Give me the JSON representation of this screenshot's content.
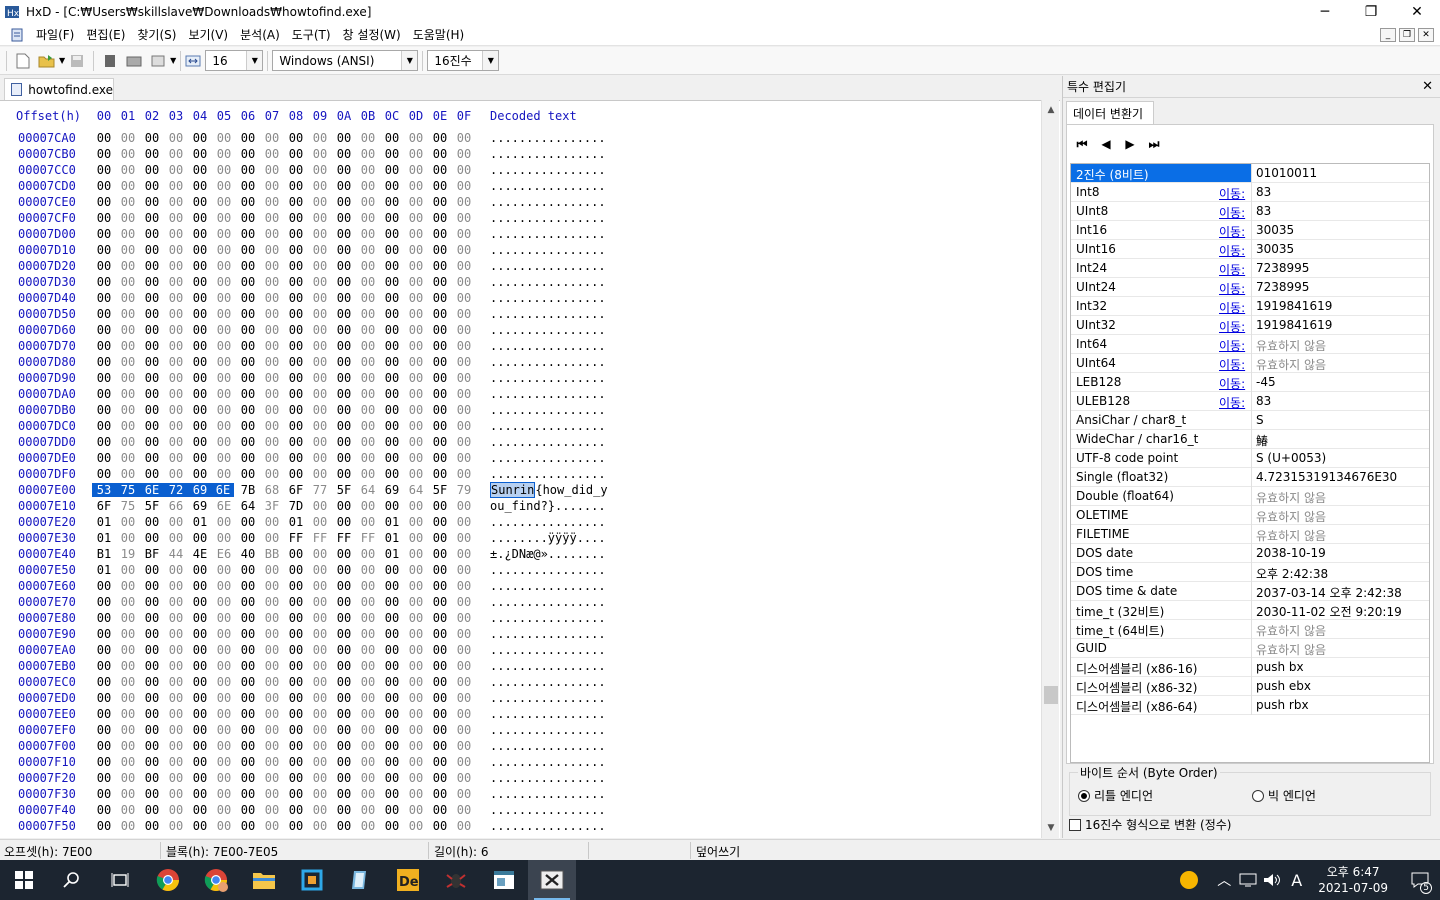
{
  "window": {
    "title": "HxD - [C:₩Users₩skillslave₩Downloads₩howtofind.exe]",
    "minimize": "─",
    "maximize": "❐",
    "close": "✕"
  },
  "menu": [
    "파일(F)",
    "편집(E)",
    "찾기(S)",
    "보기(V)",
    "분석(A)",
    "도구(T)",
    "창 설정(W)",
    "도움말(H)"
  ],
  "toolbar": {
    "bytes_per_row": "16",
    "charset": "Windows (ANSI)",
    "offset_base": "16진수"
  },
  "tab": {
    "label": "howtofind.exe"
  },
  "hex_header": {
    "offset": "Offset(h)",
    "cols": [
      "00",
      "01",
      "02",
      "03",
      "04",
      "05",
      "06",
      "07",
      "08",
      "09",
      "0A",
      "0B",
      "0C",
      "0D",
      "0E",
      "0F"
    ],
    "decoded": "Decoded text"
  },
  "rows": [
    {
      "off": "00007CA0",
      "bytes": "00 00 00 00 00 00 00 00 00 00 00 00 00 00 00 00",
      "text": "................"
    },
    {
      "off": "00007CB0",
      "bytes": "00 00 00 00 00 00 00 00 00 00 00 00 00 00 00 00",
      "text": "................"
    },
    {
      "off": "00007CC0",
      "bytes": "00 00 00 00 00 00 00 00 00 00 00 00 00 00 00 00",
      "text": "................"
    },
    {
      "off": "00007CD0",
      "bytes": "00 00 00 00 00 00 00 00 00 00 00 00 00 00 00 00",
      "text": "................"
    },
    {
      "off": "00007CE0",
      "bytes": "00 00 00 00 00 00 00 00 00 00 00 00 00 00 00 00",
      "text": "................"
    },
    {
      "off": "00007CF0",
      "bytes": "00 00 00 00 00 00 00 00 00 00 00 00 00 00 00 00",
      "text": "................"
    },
    {
      "off": "00007D00",
      "bytes": "00 00 00 00 00 00 00 00 00 00 00 00 00 00 00 00",
      "text": "................"
    },
    {
      "off": "00007D10",
      "bytes": "00 00 00 00 00 00 00 00 00 00 00 00 00 00 00 00",
      "text": "................"
    },
    {
      "off": "00007D20",
      "bytes": "00 00 00 00 00 00 00 00 00 00 00 00 00 00 00 00",
      "text": "................"
    },
    {
      "off": "00007D30",
      "bytes": "00 00 00 00 00 00 00 00 00 00 00 00 00 00 00 00",
      "text": "................"
    },
    {
      "off": "00007D40",
      "bytes": "00 00 00 00 00 00 00 00 00 00 00 00 00 00 00 00",
      "text": "................"
    },
    {
      "off": "00007D50",
      "bytes": "00 00 00 00 00 00 00 00 00 00 00 00 00 00 00 00",
      "text": "................"
    },
    {
      "off": "00007D60",
      "bytes": "00 00 00 00 00 00 00 00 00 00 00 00 00 00 00 00",
      "text": "................"
    },
    {
      "off": "00007D70",
      "bytes": "00 00 00 00 00 00 00 00 00 00 00 00 00 00 00 00",
      "text": "................"
    },
    {
      "off": "00007D80",
      "bytes": "00 00 00 00 00 00 00 00 00 00 00 00 00 00 00 00",
      "text": "................"
    },
    {
      "off": "00007D90",
      "bytes": "00 00 00 00 00 00 00 00 00 00 00 00 00 00 00 00",
      "text": "................"
    },
    {
      "off": "00007DA0",
      "bytes": "00 00 00 00 00 00 00 00 00 00 00 00 00 00 00 00",
      "text": "................"
    },
    {
      "off": "00007DB0",
      "bytes": "00 00 00 00 00 00 00 00 00 00 00 00 00 00 00 00",
      "text": "................"
    },
    {
      "off": "00007DC0",
      "bytes": "00 00 00 00 00 00 00 00 00 00 00 00 00 00 00 00",
      "text": "................"
    },
    {
      "off": "00007DD0",
      "bytes": "00 00 00 00 00 00 00 00 00 00 00 00 00 00 00 00",
      "text": "................"
    },
    {
      "off": "00007DE0",
      "bytes": "00 00 00 00 00 00 00 00 00 00 00 00 00 00 00 00",
      "text": "................"
    },
    {
      "off": "00007DF0",
      "bytes": "00 00 00 00 00 00 00 00 00 00 00 00 00 00 00 00",
      "text": "................"
    },
    {
      "off": "00007E00",
      "bytes": "53 75 6E 72 69 6E 7B 68 6F 77 5F 64 69 64 5F 79",
      "text": "Sunrin{how_did_y",
      "sel_bytes": 6
    },
    {
      "off": "00007E10",
      "bytes": "6F 75 5F 66 69 6E 64 3F 7D 00 00 00 00 00 00 00",
      "text": "ou_find?}......."
    },
    {
      "off": "00007E20",
      "bytes": "01 00 00 00 01 00 00 00 01 00 00 00 01 00 00 00",
      "text": "................"
    },
    {
      "off": "00007E30",
      "bytes": "01 00 00 00 00 00 00 00 FF FF FF FF 01 00 00 00",
      "text": "........ÿÿÿÿ...."
    },
    {
      "off": "00007E40",
      "bytes": "B1 19 BF 44 4E E6 40 BB 00 00 00 00 01 00 00 00",
      "text": "±.¿DNæ@»........"
    },
    {
      "off": "00007E50",
      "bytes": "01 00 00 00 00 00 00 00 00 00 00 00 00 00 00 00",
      "text": "................"
    },
    {
      "off": "00007E60",
      "bytes": "00 00 00 00 00 00 00 00 00 00 00 00 00 00 00 00",
      "text": "................"
    },
    {
      "off": "00007E70",
      "bytes": "00 00 00 00 00 00 00 00 00 00 00 00 00 00 00 00",
      "text": "................"
    },
    {
      "off": "00007E80",
      "bytes": "00 00 00 00 00 00 00 00 00 00 00 00 00 00 00 00",
      "text": "................"
    },
    {
      "off": "00007E90",
      "bytes": "00 00 00 00 00 00 00 00 00 00 00 00 00 00 00 00",
      "text": "................"
    },
    {
      "off": "00007EA0",
      "bytes": "00 00 00 00 00 00 00 00 00 00 00 00 00 00 00 00",
      "text": "................"
    },
    {
      "off": "00007EB0",
      "bytes": "00 00 00 00 00 00 00 00 00 00 00 00 00 00 00 00",
      "text": "................"
    },
    {
      "off": "00007EC0",
      "bytes": "00 00 00 00 00 00 00 00 00 00 00 00 00 00 00 00",
      "text": "................"
    },
    {
      "off": "00007ED0",
      "bytes": "00 00 00 00 00 00 00 00 00 00 00 00 00 00 00 00",
      "text": "................"
    },
    {
      "off": "00007EE0",
      "bytes": "00 00 00 00 00 00 00 00 00 00 00 00 00 00 00 00",
      "text": "................"
    },
    {
      "off": "00007EF0",
      "bytes": "00 00 00 00 00 00 00 00 00 00 00 00 00 00 00 00",
      "text": "................"
    },
    {
      "off": "00007F00",
      "bytes": "00 00 00 00 00 00 00 00 00 00 00 00 00 00 00 00",
      "text": "................"
    },
    {
      "off": "00007F10",
      "bytes": "00 00 00 00 00 00 00 00 00 00 00 00 00 00 00 00",
      "text": "................"
    },
    {
      "off": "00007F20",
      "bytes": "00 00 00 00 00 00 00 00 00 00 00 00 00 00 00 00",
      "text": "................"
    },
    {
      "off": "00007F30",
      "bytes": "00 00 00 00 00 00 00 00 00 00 00 00 00 00 00 00",
      "text": "................"
    },
    {
      "off": "00007F40",
      "bytes": "00 00 00 00 00 00 00 00 00 00 00 00 00 00 00 00",
      "text": "................"
    },
    {
      "off": "00007F50",
      "bytes": "00 00 00 00 00 00 00 00 00 00 00 00 00 00 00 00",
      "text": "................"
    }
  ],
  "side": {
    "title": "특수 편집기",
    "tab": "데이터 변환기",
    "goto_label": "이동:",
    "fields": [
      {
        "label": "2진수 (8비트)",
        "value": "01010011",
        "selected": true
      },
      {
        "label": "Int8",
        "value": "83",
        "link": true
      },
      {
        "label": "UInt8",
        "value": "83",
        "link": true
      },
      {
        "label": "Int16",
        "value": "30035",
        "link": true
      },
      {
        "label": "UInt16",
        "value": "30035",
        "link": true
      },
      {
        "label": "Int24",
        "value": "7238995",
        "link": true
      },
      {
        "label": "UInt24",
        "value": "7238995",
        "link": true
      },
      {
        "label": "Int32",
        "value": "1919841619",
        "link": true
      },
      {
        "label": "UInt32",
        "value": "1919841619",
        "link": true
      },
      {
        "label": "Int64",
        "value": "유효하지 않음",
        "link": true,
        "invalid": true
      },
      {
        "label": "UInt64",
        "value": "유효하지 않음",
        "link": true,
        "invalid": true
      },
      {
        "label": "LEB128",
        "value": "-45",
        "link": true
      },
      {
        "label": "ULEB128",
        "value": "83",
        "link": true
      },
      {
        "label": "AnsiChar / char8_t",
        "value": "S"
      },
      {
        "label": "WideChar / char16_t",
        "value": "鰆"
      },
      {
        "label": "UTF-8 code point",
        "value": "S (U+0053)"
      },
      {
        "label": "Single (float32)",
        "value": "4.72315319134676E30"
      },
      {
        "label": "Double (float64)",
        "value": "유효하지 않음",
        "invalid": true
      },
      {
        "label": "OLETIME",
        "value": "유효하지 않음",
        "invalid": true
      },
      {
        "label": "FILETIME",
        "value": "유효하지 않음",
        "invalid": true
      },
      {
        "label": "DOS date",
        "value": "2038-10-19"
      },
      {
        "label": "DOS time",
        "value": "오후 2:42:38"
      },
      {
        "label": "DOS time & date",
        "value": "2037-03-14 오후 2:42:38"
      },
      {
        "label": "time_t (32비트)",
        "value": "2030-11-02 오전 9:20:19"
      },
      {
        "label": "time_t (64비트)",
        "value": "유효하지 않음",
        "invalid": true
      },
      {
        "label": "GUID",
        "value": "유효하지 않음",
        "invalid": true
      },
      {
        "label": "디스어셈블리 (x86-16)",
        "value": "push bx"
      },
      {
        "label": "디스어셈블리 (x86-32)",
        "value": "push ebx"
      },
      {
        "label": "디스어셈블리 (x86-64)",
        "value": "push rbx"
      }
    ],
    "byte_order": {
      "legend": "바이트 순서 (Byte Order)",
      "little": "리틀 엔디언",
      "big": "빅 엔디언"
    },
    "hex_convert": "16진수 형식으로 변환 (정수)"
  },
  "status": {
    "offset": "오프셋(h): 7E00",
    "block": "블록(h): 7E00-7E05",
    "length": "길이(h): 6",
    "mode": "덮어쓰기"
  },
  "taskbar": {
    "time": "오후 6:47",
    "date": "2021-07-09",
    "ime": "A",
    "notif": "5"
  },
  "colors": {
    "selection": "#0a5fd0",
    "offset_blue": "#1515c0",
    "taskbar": "#1c2530"
  }
}
